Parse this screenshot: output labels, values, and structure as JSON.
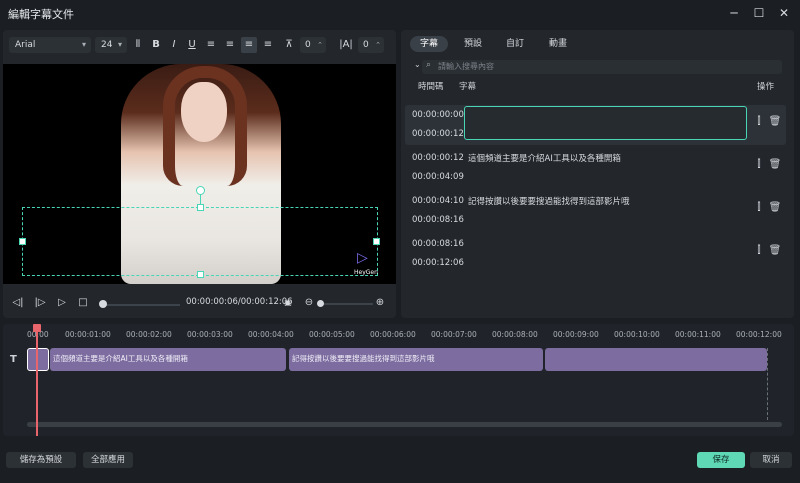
{
  "window": {
    "title": "編輯字幕文件",
    "controls": {
      "minimize": "─",
      "maximize": "☐",
      "close": "✕"
    }
  },
  "toolbar": {
    "font": "Arial",
    "font_size": "24",
    "bold": "B",
    "italic": "I",
    "underline": "U",
    "spacing_value": "0",
    "line_spacing_value": "0"
  },
  "preview": {
    "logo_text": "HeyGen"
  },
  "player": {
    "timecode": "00:00:00:06/00:00:12:06"
  },
  "right_panel": {
    "tabs": [
      {
        "label": "字幕",
        "active": true
      },
      {
        "label": "預設",
        "active": false
      },
      {
        "label": "自訂",
        "active": false
      },
      {
        "label": "動畫",
        "active": false
      }
    ],
    "search_placeholder": "請輸入搜尋內容",
    "columns": {
      "timecode": "時間碼",
      "subtitle": "字幕",
      "action": "操作"
    },
    "rows": [
      {
        "start": "00:00:00:00",
        "end": "00:00:00:12",
        "text": ""
      },
      {
        "start": "00:00:00:12",
        "end": "00:00:04:09",
        "text": "這個頻道主要是介紹AI工具以及各種開箱"
      },
      {
        "start": "00:00:04:10",
        "end": "00:00:08:16",
        "text": "記得按讚以後要要搜過能找得到這部影片哦"
      },
      {
        "start": "00:00:08:16",
        "end": "00:00:12:06",
        "text": ""
      }
    ]
  },
  "timeline": {
    "ticks": [
      "00:00",
      "00:00:01:00",
      "00:00:02:00",
      "00:00:03:00",
      "00:00:04:00",
      "00:00:05:00",
      "00:00:06:00",
      "00:00:07:00",
      "00:00:08:00",
      "00:00:09:00",
      "00:00:10:00",
      "00:00:11:00",
      "00:00:12:00"
    ],
    "clips": [
      {
        "text": ""
      },
      {
        "text": "這個頻道主要是介紹AI工具以及各種開箱"
      },
      {
        "text": "記得按讚以後要要搜過能找得到這部影片哦"
      },
      {
        "text": ""
      }
    ]
  },
  "footer": {
    "save_preset": "儲存為預設",
    "apply_all": "全部應用",
    "save": "保存",
    "cancel": "取消"
  },
  "colors": {
    "accent": "#48d6b6",
    "clip": "#7c6c9f",
    "playhead": "#e8656b",
    "primary_button": "#5fd9b5"
  }
}
